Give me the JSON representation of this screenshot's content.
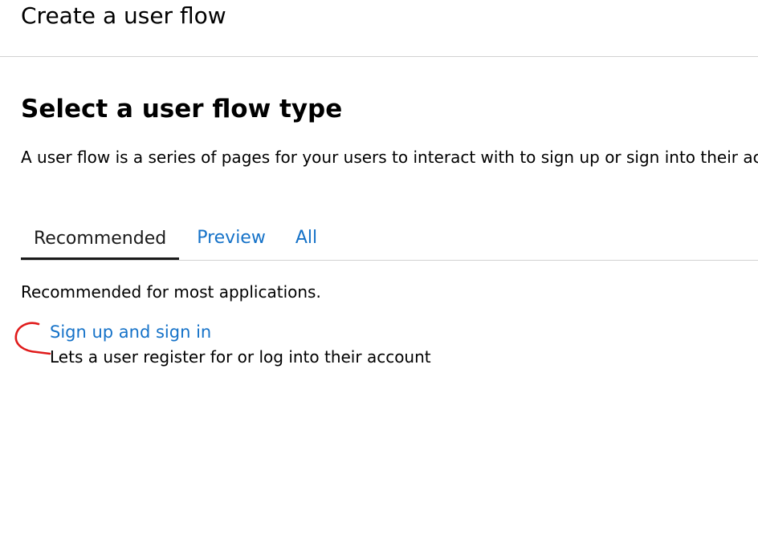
{
  "window": {
    "title": "Create a user flow"
  },
  "main": {
    "heading": "Select a user flow type",
    "description": "A user flow is a series of pages for your users to interact with to sign up or sign into their ac",
    "tabs": [
      {
        "label": "Recommended",
        "active": true
      },
      {
        "label": "Preview",
        "active": false
      },
      {
        "label": "All",
        "active": false
      }
    ],
    "tab_subtitle": "Recommended for most applications.",
    "flow_options": [
      {
        "title": "Sign up and sign in",
        "description": "Lets a user register for or log into their account"
      }
    ]
  },
  "colors": {
    "link": "#1572c8",
    "annotation": "#e01b1b"
  }
}
